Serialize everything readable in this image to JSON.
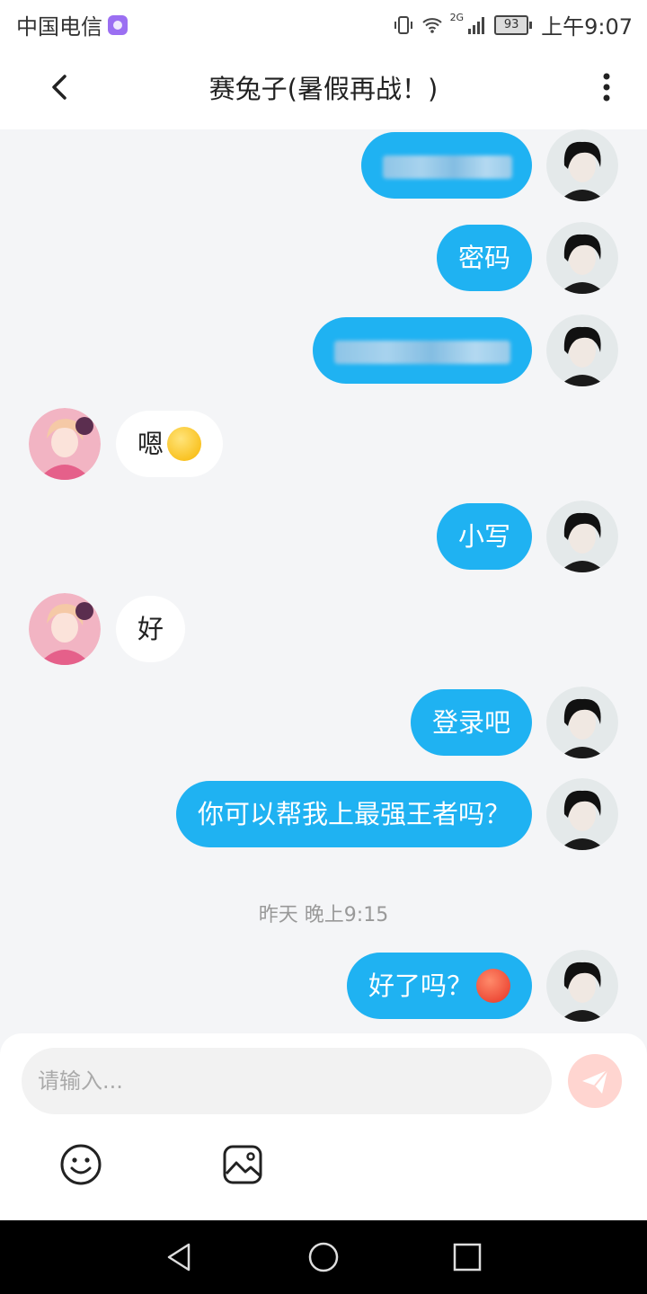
{
  "status_bar": {
    "carrier": "中国电信",
    "network": "2G",
    "battery": "93",
    "time": "上午9:07"
  },
  "header": {
    "title": "赛兔子(暑假再战！)",
    "back_icon": "chevron-left-icon",
    "more_icon": "more-vertical-icon"
  },
  "messages": [
    {
      "side": "me",
      "text": "",
      "redacted": true
    },
    {
      "side": "me",
      "text": "密码"
    },
    {
      "side": "me",
      "text": "",
      "redacted": true
    },
    {
      "side": "other",
      "text": "嗯",
      "emoji": "smiling-face-icon"
    },
    {
      "side": "me",
      "text": "小写"
    },
    {
      "side": "other",
      "text": "好"
    },
    {
      "side": "me",
      "text": "登录吧"
    },
    {
      "side": "me",
      "text": "你可以帮我上最强王者吗？"
    },
    {
      "side": "me",
      "text": "好了吗？",
      "emoji": "angry-face-icon"
    }
  ],
  "timestamp": "昨天 晚上9:15",
  "input": {
    "placeholder": "请输入...",
    "value": ""
  },
  "toolbar": {
    "emoji_icon": "emoji-icon",
    "image_icon": "image-icon",
    "send_icon": "send-icon"
  },
  "colors": {
    "my_bubble": "#1fb2f2",
    "other_bubble": "#ffffff",
    "background": "#f4f5f7",
    "send_button": "#ffd5d0"
  }
}
